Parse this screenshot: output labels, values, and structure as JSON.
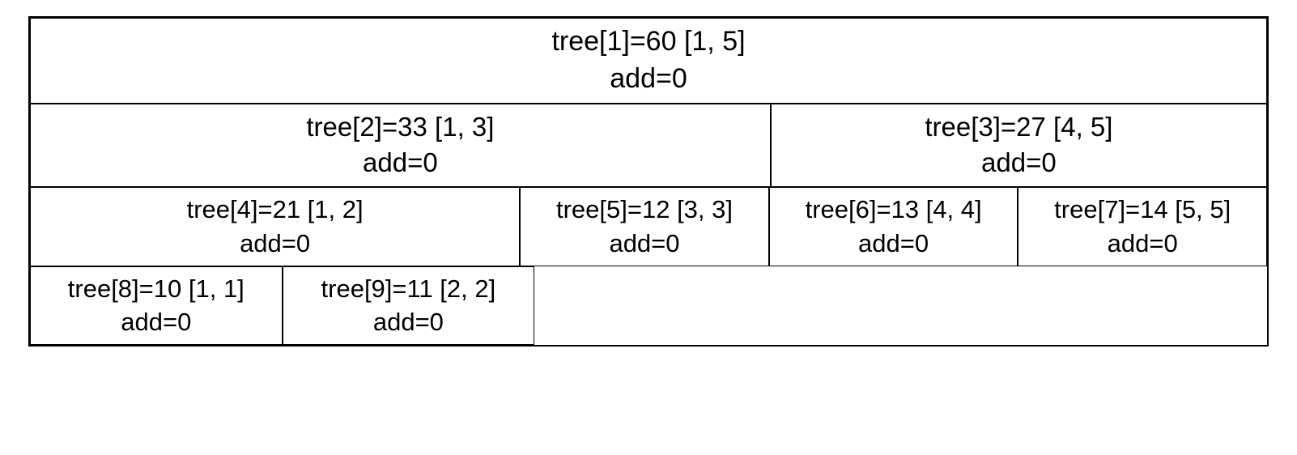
{
  "nodes": {
    "n1": {
      "line1": "tree[1]=60 [1, 5]",
      "line2": "add=0"
    },
    "n2": {
      "line1": "tree[2]=33 [1, 3]",
      "line2": "add=0"
    },
    "n3": {
      "line1": "tree[3]=27 [4, 5]",
      "line2": "add=0"
    },
    "n4": {
      "line1": "tree[4]=21 [1, 2]",
      "line2": "add=0"
    },
    "n5": {
      "line1": "tree[5]=12 [3, 3]",
      "line2": "add=0"
    },
    "n6": {
      "line1": "tree[6]=13 [4, 4]",
      "line2": "add=0"
    },
    "n7": {
      "line1": "tree[7]=14 [5, 5]",
      "line2": "add=0"
    },
    "n8": {
      "line1": "tree[8]=10 [1, 1]",
      "line2": "add=0"
    },
    "n9": {
      "line1": "tree[9]=11 [2, 2]",
      "line2": "add=0"
    }
  }
}
